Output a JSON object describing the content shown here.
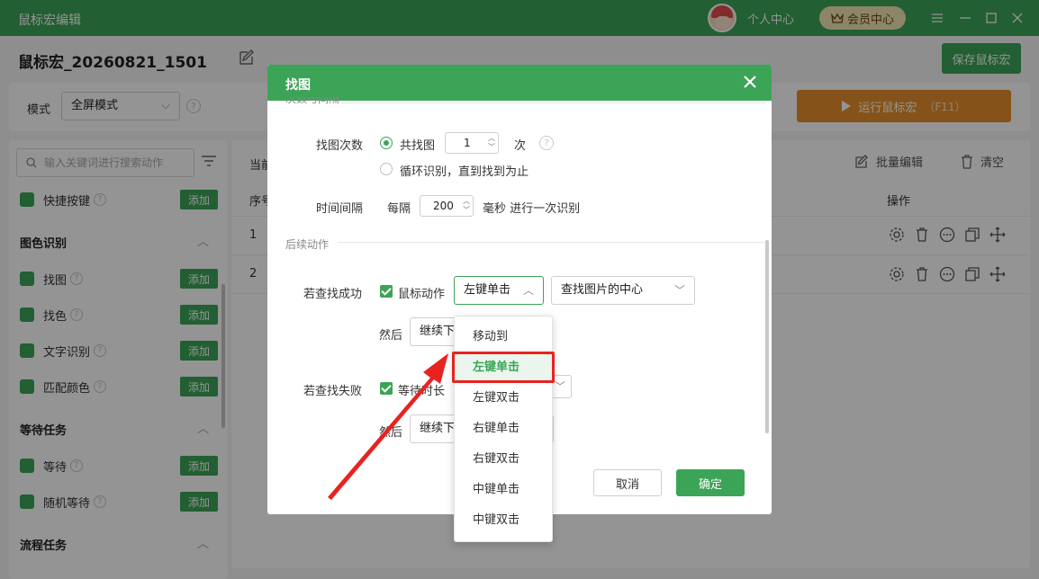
{
  "titlebar": {
    "title": "鼠标宏编辑",
    "user_center": "个人中心",
    "vip": "会员中心"
  },
  "header": {
    "macro_name": "鼠标宏_20260821_1501",
    "save_label": "保存鼠标宏"
  },
  "mode": {
    "label": "模式",
    "value": "全屏模式",
    "run_label": "运行鼠标宏",
    "run_hotkey": "（F11）"
  },
  "sidebar": {
    "search_placeholder": "输入关键词进行搜索动作",
    "add_label": "添加",
    "top_item": "快捷按键",
    "sections": {
      "color": "图色识别",
      "wait": "等待任务",
      "flow": "流程任务"
    },
    "items": {
      "find_image": "找图",
      "find_color": "找色",
      "ocr": "文字识别",
      "match_color": "匹配颜色",
      "wait": "等待",
      "random_wait": "随机等待"
    }
  },
  "main": {
    "current_label": "当前",
    "batch_edit": "批量编辑",
    "clear": "清空",
    "col_seq": "序号",
    "col_ops": "操作",
    "rows": [
      "1",
      "2"
    ]
  },
  "dialog": {
    "title": "找图",
    "section_count_interval": "次数与间隔",
    "find_count_label": "找图次数",
    "total_find_label": "共找图",
    "count_value": "1",
    "count_unit": "次",
    "loop_label": "循环识别，直到找到为止",
    "interval_label": "时间间隔",
    "every_label": "每隔",
    "interval_value": "200",
    "interval_suffix": "毫秒 进行一次识别",
    "section_follow": "后续动作",
    "success_label": "若查找成功",
    "mouse_action_label": "鼠标动作",
    "mouse_action_value": "左键单击",
    "target_value": "查找图片的中心",
    "then_label": "然后",
    "then_value": "继续下",
    "fail_label": "若查找失败",
    "wait_label": "等待时长",
    "cancel": "取消",
    "ok": "确定"
  },
  "dropdown": {
    "options": [
      "移动到",
      "左键单击",
      "左键双击",
      "右键单击",
      "右键双击",
      "中键单击",
      "中键双击"
    ],
    "selected_index": 1
  },
  "colors": {
    "brand_green": "#3ca457",
    "run_orange": "#e6902c",
    "highlight_red": "#e8231f"
  }
}
